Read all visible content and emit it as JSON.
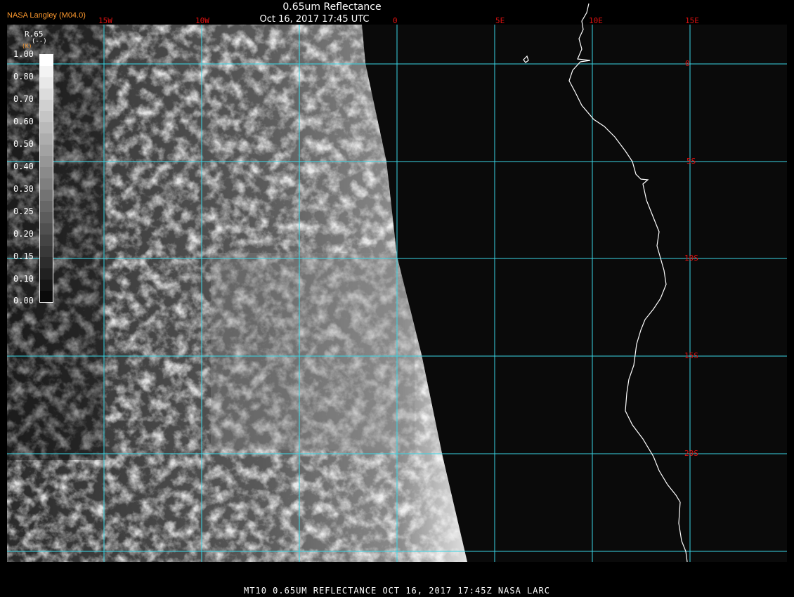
{
  "header": {
    "title": "0.65um Reflectance",
    "subtitle": "Oct 16, 2017 17:45 UTC",
    "credit": "NASA Langley (M04.0)"
  },
  "footer": "MT10  0.65UM REFLECTANCE  OCT 16, 2017 17:45Z  NASA LARC",
  "legend": {
    "title": "R.65",
    "unit": "(--)",
    "subunit": "(K)",
    "ticks": [
      "1.00",
      "0.80",
      "0.70",
      "0.60",
      "0.50",
      "0.40",
      "0.30",
      "0.25",
      "0.20",
      "0.15",
      "0.10",
      "0.00"
    ]
  },
  "grid": {
    "lon_labels": [
      "15W",
      "10W",
      "0",
      "5E",
      "10E",
      "15E"
    ],
    "lat_labels": [
      "0",
      "5S",
      "10S",
      "15S",
      "20S"
    ]
  },
  "colors": {
    "grid": "#39d7e6",
    "labels": "#e01010",
    "coast": "#ffffff",
    "background": "#0a0a0a",
    "credit": "#ff9a2e"
  }
}
